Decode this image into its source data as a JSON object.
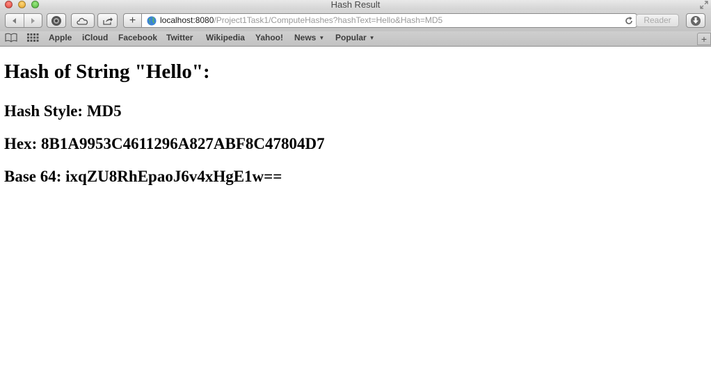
{
  "window": {
    "title": "Hash Result"
  },
  "toolbar": {
    "url_host": "localhost:8080",
    "url_path": "/Project1Task1/ComputeHashes?hashText=Hello&Hash=MD5",
    "reader_label": "Reader",
    "add_label": "+"
  },
  "bookmarks": {
    "items": [
      {
        "label": "Apple"
      },
      {
        "label": "iCloud"
      },
      {
        "label": "Facebook"
      },
      {
        "label": "Twitter"
      },
      {
        "label": "Wikipedia"
      },
      {
        "label": "Yahoo!"
      },
      {
        "label": "News",
        "has_menu": true
      },
      {
        "label": "Popular",
        "has_menu": true
      }
    ],
    "new_tab_label": "+"
  },
  "page": {
    "heading": "Hash of String \"Hello\":",
    "hash_style": "Hash Style: MD5",
    "hex": "Hex: 8B1A9953C4611296A827ABF8C47804D7",
    "base64": "Base 64: ixqZU8RhEpaoJ6v4xHgE1w=="
  },
  "icons": {
    "back": "back-arrow-icon",
    "forward": "forward-arrow-icon",
    "top_sites": "top-sites-icon",
    "icloud": "cloud-icon",
    "share": "share-icon",
    "site": "globe-icon",
    "reload": "reload-icon",
    "download": "download-icon",
    "reading_list": "book-icon",
    "grid": "grid-icon"
  }
}
